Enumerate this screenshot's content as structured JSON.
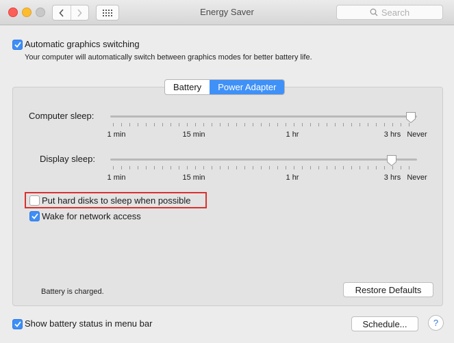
{
  "window": {
    "title": "Energy Saver",
    "search_placeholder": "Search"
  },
  "graphics": {
    "checkbox_checked": true,
    "label": "Automatic graphics switching",
    "description": "Your computer will automatically switch between graphics modes for better battery life."
  },
  "tabs": [
    {
      "label": "Battery",
      "selected": false
    },
    {
      "label": "Power Adapter",
      "selected": true
    }
  ],
  "sliders": {
    "computer_sleep": {
      "label": "Computer sleep:",
      "value": "Never",
      "ticks": [
        "1 min",
        "15 min",
        "1 hr",
        "3 hrs",
        "Never"
      ]
    },
    "display_sleep": {
      "label": "Display sleep:",
      "value": "3 hrs",
      "ticks": [
        "1 min",
        "15 min",
        "1 hr",
        "3 hrs",
        "Never"
      ]
    }
  },
  "options": {
    "hard_disks": {
      "label": "Put hard disks to sleep when possible",
      "checked": false
    },
    "wake_network": {
      "label": "Wake for network access",
      "checked": true
    }
  },
  "status": {
    "battery_text": "Battery is charged."
  },
  "buttons": {
    "restore_defaults": "Restore Defaults",
    "schedule": "Schedule...",
    "help": "?"
  },
  "footer": {
    "show_battery_status": {
      "label": "Show battery status in menu bar",
      "checked": true
    }
  },
  "colors": {
    "accent": "#3f91f7",
    "highlight_box": "#d9302f"
  }
}
